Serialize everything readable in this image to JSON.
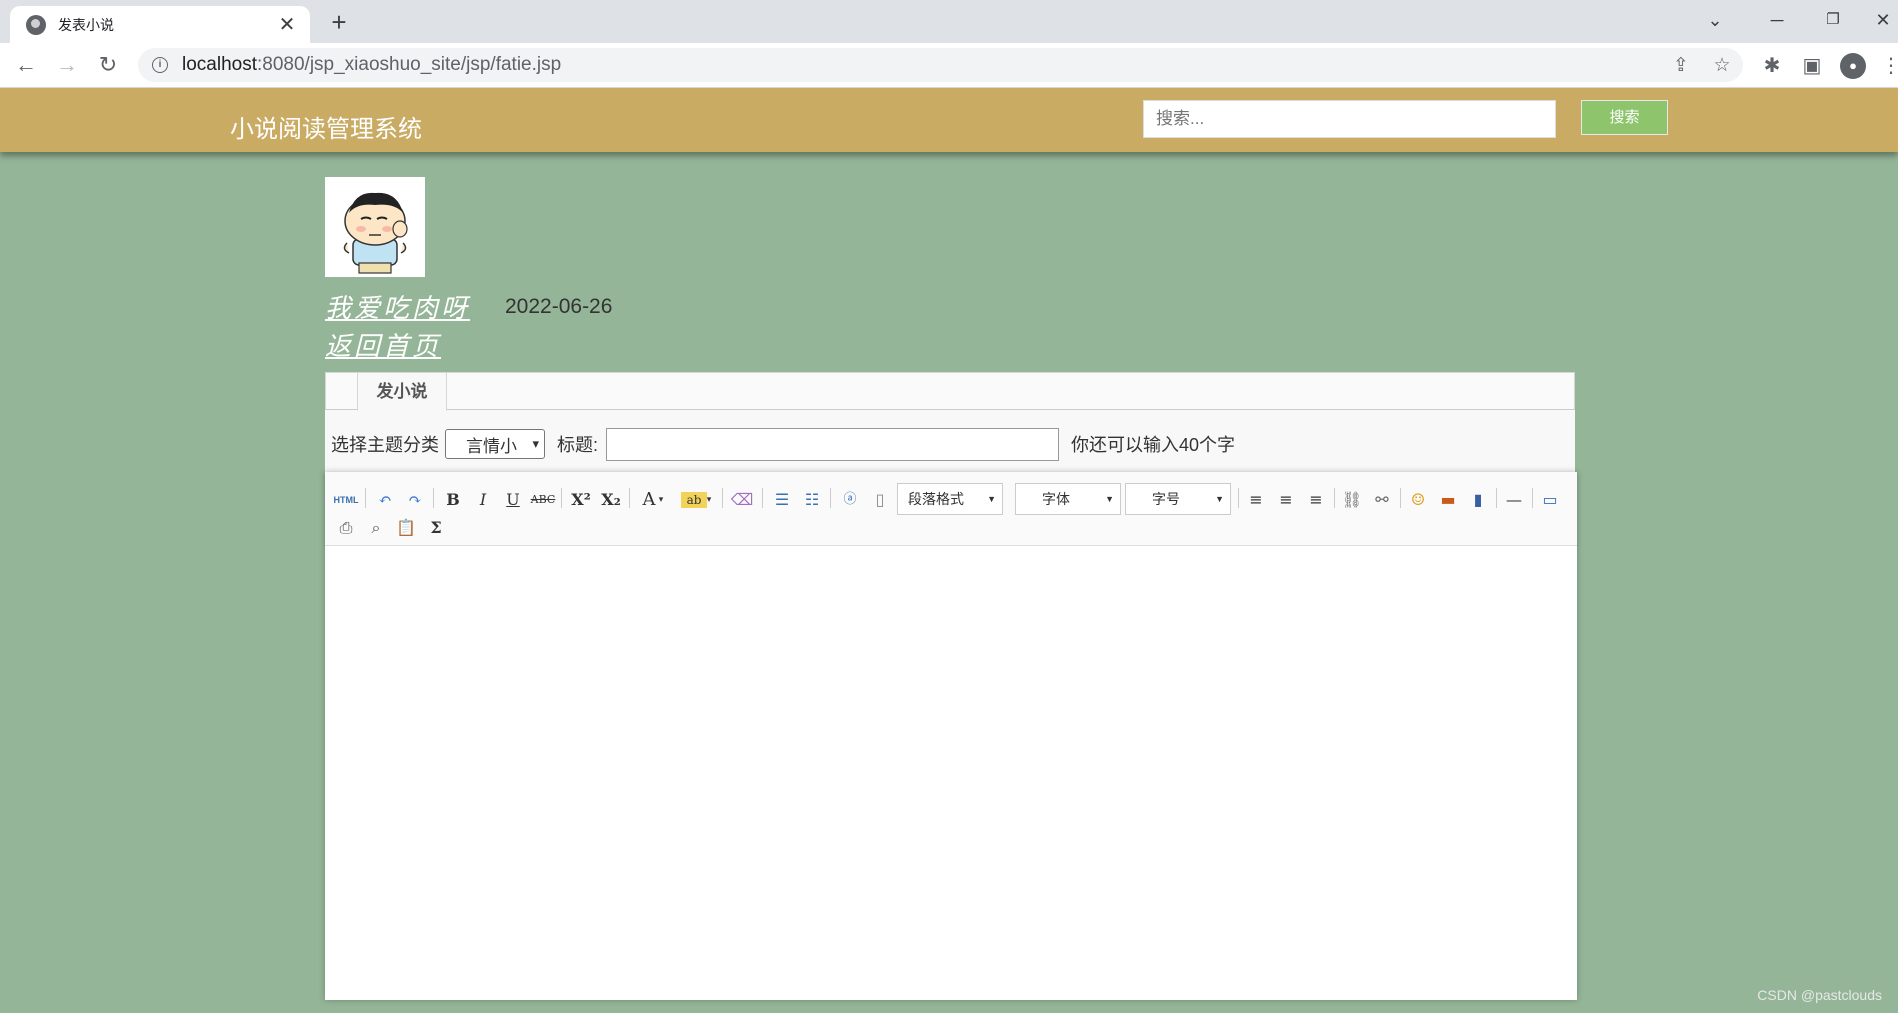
{
  "browser": {
    "tab_title": "发表小说",
    "url_host": "localhost",
    "url_path": ":8080/jsp_xiaoshuo_site/jsp/fatie.jsp"
  },
  "header": {
    "site_title": "小说阅读管理系统",
    "search_placeholder": "搜索...",
    "search_button": "搜索"
  },
  "user": {
    "username": "我爱吃肉呀",
    "date": "2022-06-26",
    "home_link": "返回首页"
  },
  "form": {
    "tab_label": "发小说",
    "category_label": "选择主题分类",
    "category_selected": "言情小",
    "title_label": "标题:",
    "title_value": "",
    "char_hint": "你还可以输入40个字"
  },
  "editor": {
    "html_label": "HTML",
    "paragraph_label": "段落格式",
    "font_label": "字体",
    "size_label": "字号"
  },
  "watermark": "CSDN @pastclouds"
}
